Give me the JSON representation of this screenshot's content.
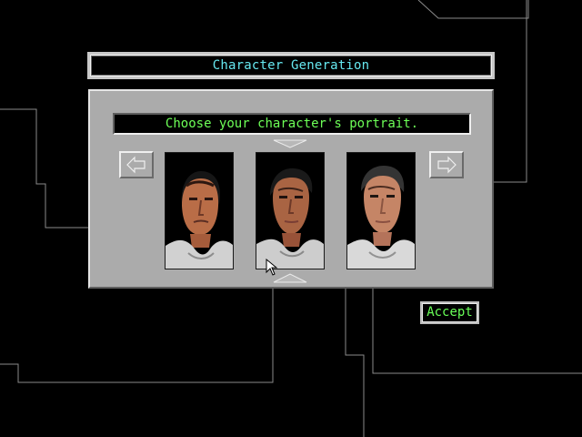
{
  "window": {
    "title": "Character Generation"
  },
  "panel": {
    "prompt": "Choose your character's portrait.",
    "portraits": [
      {
        "name": "portrait-1"
      },
      {
        "name": "portrait-2"
      },
      {
        "name": "portrait-3"
      }
    ]
  },
  "controls": {
    "previous_icon": "left-arrow-icon",
    "next_icon": "right-arrow-icon",
    "accept_label": "Accept"
  },
  "colors": {
    "title_text": "#66e8f0",
    "prompt_text": "#6dff57",
    "accept_text": "#69ff58",
    "panel_bg": "#ababab",
    "line_color": "#8a8a8a"
  }
}
